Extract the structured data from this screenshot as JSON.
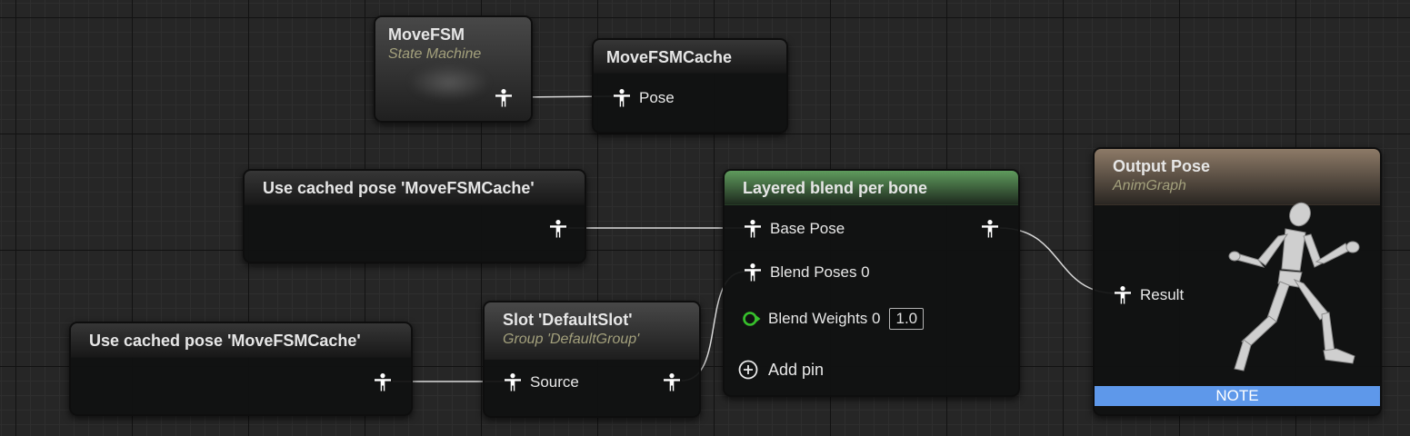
{
  "nodes": {
    "move_fsm": {
      "title": "MoveFSM",
      "subtitle": "State Machine"
    },
    "move_fsm_cache": {
      "title": "MoveFSMCache",
      "pin_pose": "Pose"
    },
    "cached_pose_1": {
      "title": "Use cached pose 'MoveFSMCache'"
    },
    "cached_pose_2": {
      "title": "Use cached pose 'MoveFSMCache'"
    },
    "slot": {
      "title": "Slot 'DefaultSlot'",
      "subtitle": "Group 'DefaultGroup'",
      "pin_source": "Source"
    },
    "layered_blend": {
      "title": "Layered blend per bone",
      "pin_base_pose": "Base Pose",
      "pin_blend_poses": "Blend Poses 0",
      "pin_blend_weights": "Blend Weights 0",
      "blend_weights_value": "1.0",
      "add_pin": "Add pin"
    },
    "output_pose": {
      "title": "Output Pose",
      "subtitle": "AnimGraph",
      "pin_result": "Result",
      "note": "NOTE"
    }
  },
  "icons": {
    "pose_pin": "pose-pin-icon",
    "float_pin": "float-pin-icon",
    "add": "add-pin-icon",
    "preview": "mannequin-preview"
  },
  "colors": {
    "background": "#262626",
    "wire": "#d8d8d8",
    "green_header": "#5f9b5d",
    "brown_header": "#8d7a67",
    "note_bar": "#5e98ea",
    "float_pin": "#37c02c",
    "subtitle": "#a3a07c"
  }
}
